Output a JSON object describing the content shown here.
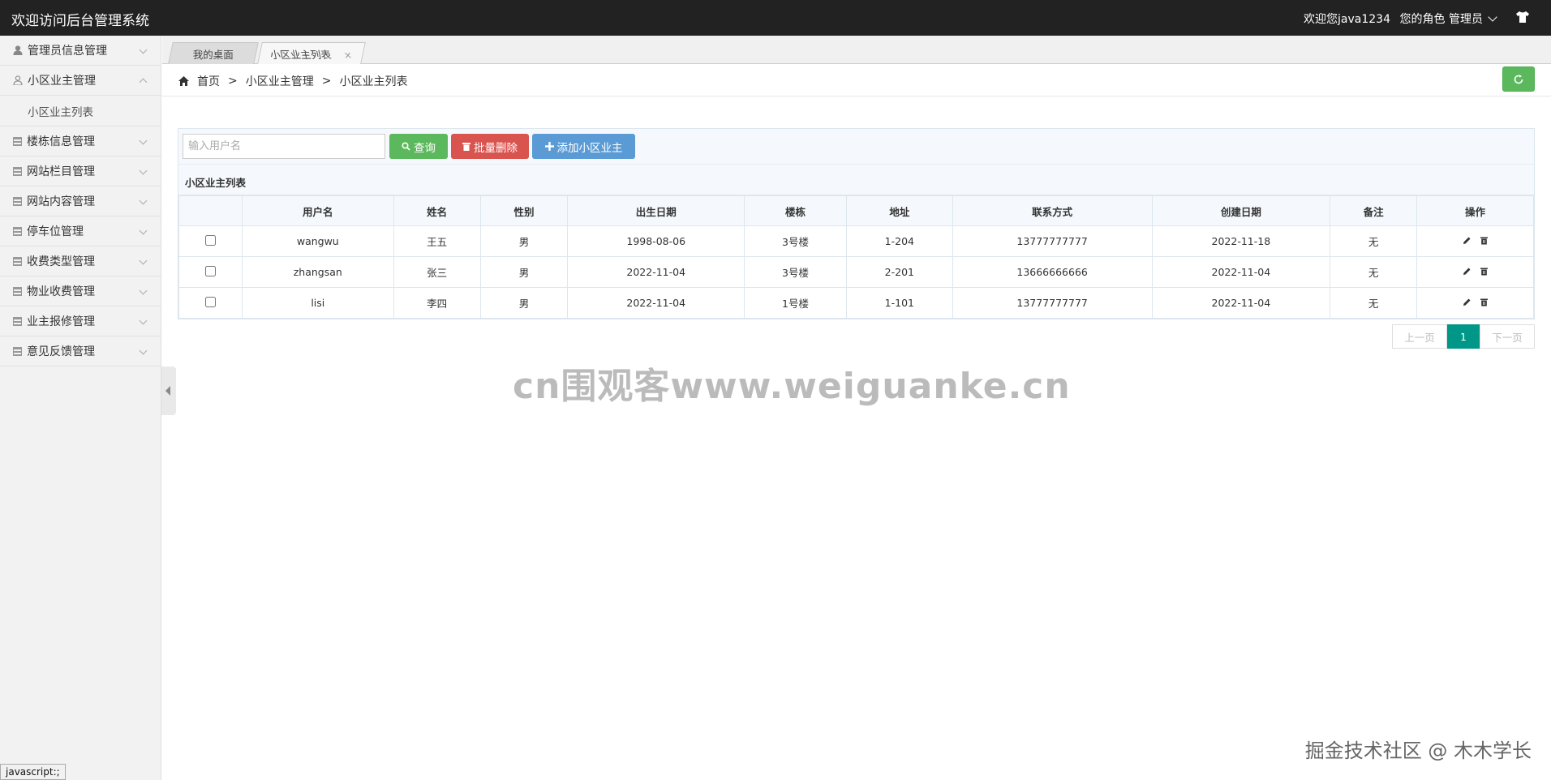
{
  "header": {
    "title": "欢迎访问后台管理系统",
    "welcome": "欢迎您java1234",
    "role": "您的角色 管理员"
  },
  "sidebar": {
    "items": [
      {
        "label": "管理员信息管理",
        "icon": "user-icon",
        "expanded": false
      },
      {
        "label": "小区业主管理",
        "icon": "user-outline-icon",
        "expanded": true,
        "children": [
          {
            "label": "小区业主列表"
          }
        ]
      },
      {
        "label": "楼栋信息管理",
        "icon": "doc-icon",
        "expanded": false
      },
      {
        "label": "网站栏目管理",
        "icon": "doc-icon",
        "expanded": false
      },
      {
        "label": "网站内容管理",
        "icon": "doc-icon",
        "expanded": false
      },
      {
        "label": "停车位管理",
        "icon": "doc-icon",
        "expanded": false
      },
      {
        "label": "收费类型管理",
        "icon": "doc-icon",
        "expanded": false
      },
      {
        "label": "物业收费管理",
        "icon": "doc-icon",
        "expanded": false
      },
      {
        "label": "业主报修管理",
        "icon": "doc-icon",
        "expanded": false
      },
      {
        "label": "意见反馈管理",
        "icon": "doc-icon",
        "expanded": false
      }
    ]
  },
  "tabs": [
    {
      "label": "我的桌面",
      "active": false
    },
    {
      "label": "小区业主列表",
      "active": true,
      "close": "×"
    }
  ],
  "breadcrumb": [
    "首页",
    "小区业主管理",
    "小区业主列表"
  ],
  "breadcrumb_sep": ">",
  "toolbar": {
    "search_placeholder": "输入用户名",
    "query_label": "查询",
    "delete_label": "批量删除",
    "add_label": "添加小区业主"
  },
  "panel_title": "小区业主列表",
  "table": {
    "columns": [
      "",
      "用户名",
      "姓名",
      "性别",
      "出生日期",
      "楼栋",
      "地址",
      "联系方式",
      "创建日期",
      "备注",
      "操作"
    ],
    "rows": [
      [
        "wangwu",
        "王五",
        "男",
        "1998-08-06",
        "3号楼",
        "1-204",
        "13777777777",
        "2022-11-18",
        "无"
      ],
      [
        "zhangsan",
        "张三",
        "男",
        "2022-11-04",
        "3号楼",
        "2-201",
        "13666666666",
        "2022-11-04",
        "无"
      ],
      [
        "lisi",
        "李四",
        "男",
        "2022-11-04",
        "1号楼",
        "1-101",
        "13777777777",
        "2022-11-04",
        "无"
      ]
    ]
  },
  "pagination": {
    "prev": "上一页",
    "current": "1",
    "next": "下一页"
  },
  "watermark_center": "cn围观客www.weiguanke.cn",
  "watermark_corner": "掘金技术社区 @ 木木学长",
  "status_tip": "javascript:;",
  "colors": {
    "header_bg": "#222222",
    "query_btn": "#5cb85c",
    "delete_btn": "#d9534f",
    "add_btn": "#5b9bd5",
    "page_active": "#009688"
  }
}
